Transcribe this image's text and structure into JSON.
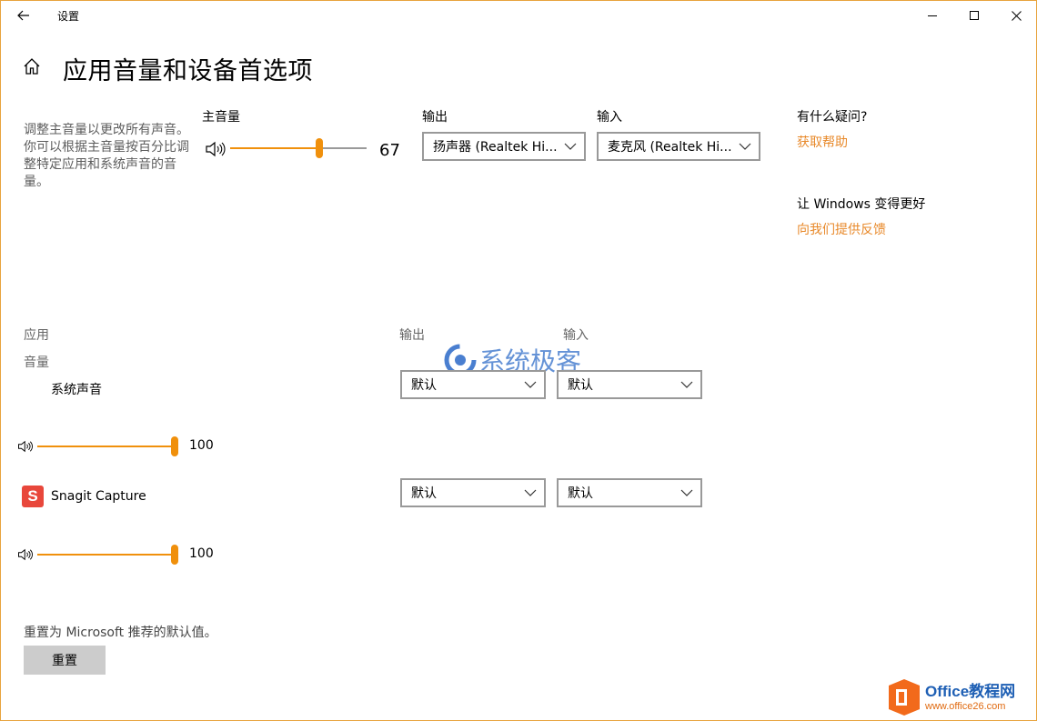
{
  "titlebar": {
    "title": "设置",
    "back_icon": "back-arrow-icon",
    "min_icon": "minimize-icon",
    "max_icon": "maximize-icon",
    "close_icon": "close-icon"
  },
  "page": {
    "title": "应用音量和设备首选项",
    "home_icon": "home-icon"
  },
  "master": {
    "description": "调整主音量以更改所有声音。你可以根据主音量按百分比调整特定应用和系统声音的音量。",
    "label": "主音量",
    "volume": 67,
    "volume_text": "67",
    "output_label": "输出",
    "output_value": "扬声器 (Realtek Hi...",
    "input_label": "输入",
    "input_value": "麦克风 (Realtek Hi..."
  },
  "help": {
    "question": "有什么疑问?",
    "help_link": "获取帮助",
    "improve": "让 Windows 变得更好",
    "feedback_link": "向我们提供反馈"
  },
  "apps": {
    "col_app": "应用",
    "col_volume": "音量",
    "col_output": "输出",
    "col_input": "输入",
    "items": [
      {
        "name": "系统声音",
        "volume": 100,
        "volume_text": "100",
        "output": "默认",
        "input": "默认"
      },
      {
        "name": "Snagit Capture",
        "volume": 100,
        "volume_text": "100",
        "output": "默认",
        "input": "默认",
        "icon": "snagit-app-icon",
        "icon_letter": "S"
      }
    ]
  },
  "reset": {
    "description": "重置为 Microsoft 推荐的默认值。",
    "button": "重置"
  },
  "watermarks": {
    "center": "系统极客",
    "brand_main": "Office教程网",
    "brand_url": "www.office26.com"
  },
  "colors": {
    "accent": "#f0900c",
    "link": "#e8892a",
    "track_gray": "#9a9a9a",
    "brand_orange": "#f26a1b",
    "snagit_red": "#e8473b"
  }
}
